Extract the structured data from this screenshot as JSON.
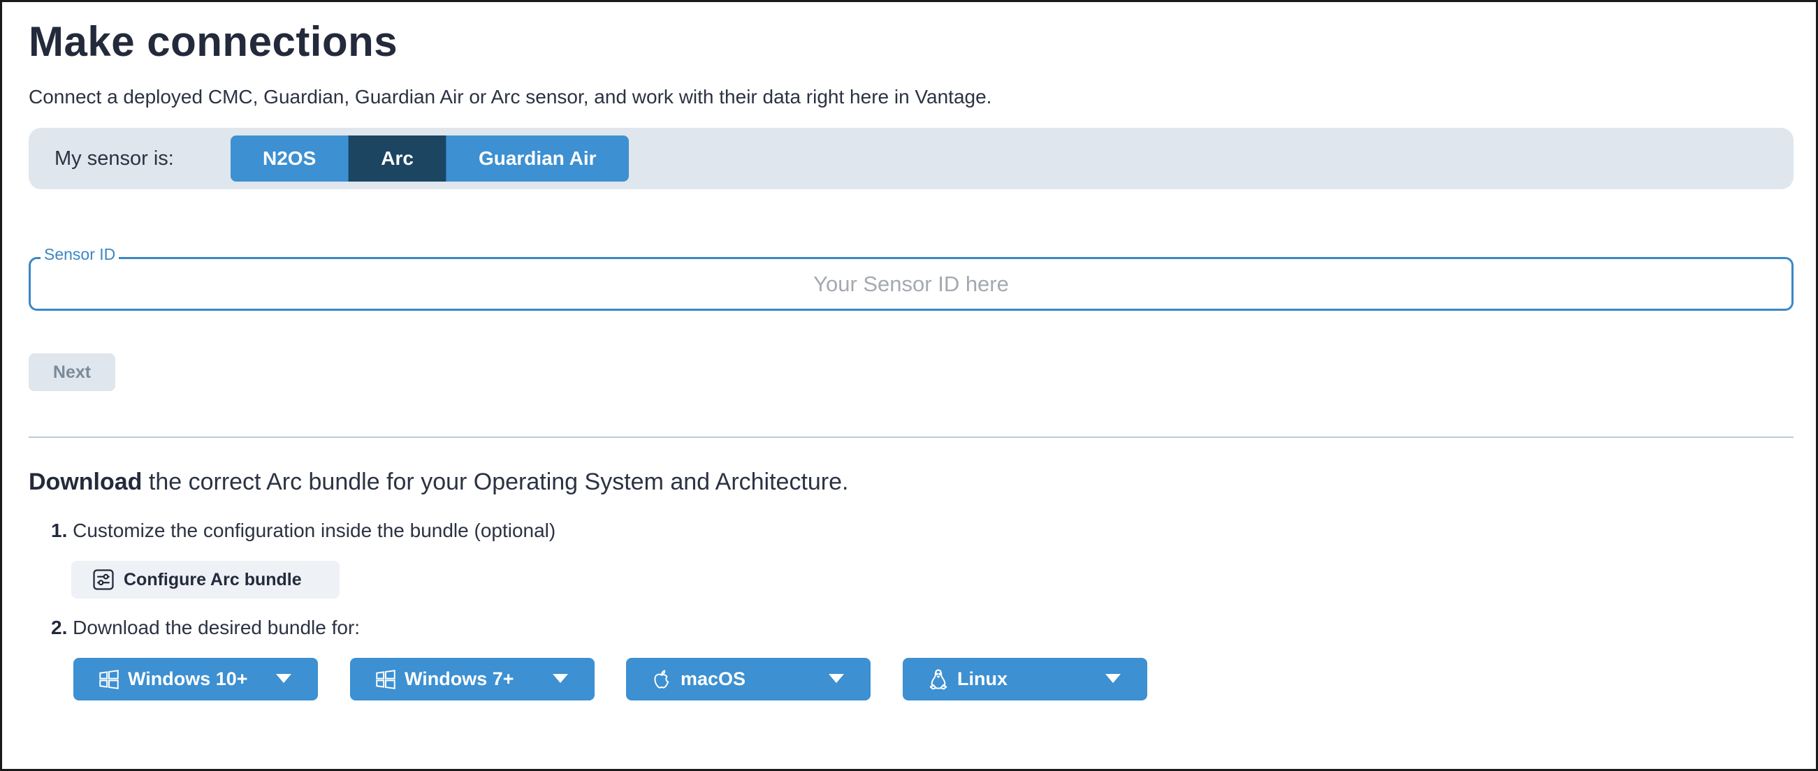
{
  "header": {
    "title": "Make connections",
    "subtitle": "Connect a deployed CMC, Guardian, Guardian Air or Arc sensor, and work with their data right here in Vantage."
  },
  "sensor_selector": {
    "label": "My sensor is:",
    "options": [
      "N2OS",
      "Arc",
      "Guardian Air"
    ],
    "selected": "Arc"
  },
  "sensor_field": {
    "legend": "Sensor ID",
    "value": "",
    "placeholder": "Your Sensor ID here"
  },
  "next_button": {
    "label": "Next",
    "disabled": true
  },
  "download": {
    "heading_bold": "Download",
    "heading_rest": " the correct Arc bundle for your Operating System and Architecture.",
    "step1": {
      "number": "1.",
      "text": "Customize the configuration inside the bundle (optional)"
    },
    "configure_button": {
      "label": "Configure Arc bundle",
      "icon": "sliders-icon"
    },
    "step2": {
      "number": "2.",
      "text": "Download the desired bundle for:"
    },
    "os_buttons": [
      {
        "label": "Windows 10+",
        "icon": "windows-icon"
      },
      {
        "label": "Windows 7+",
        "icon": "windows-icon"
      },
      {
        "label": "macOS",
        "icon": "apple-icon"
      },
      {
        "label": "Linux",
        "icon": "linux-icon"
      }
    ]
  },
  "colors": {
    "primary": "#3d90d1",
    "primary_active": "#1b4561",
    "focus_border": "#3b87c6",
    "bar_background": "#dfe6ee",
    "text": "#232a3b"
  }
}
